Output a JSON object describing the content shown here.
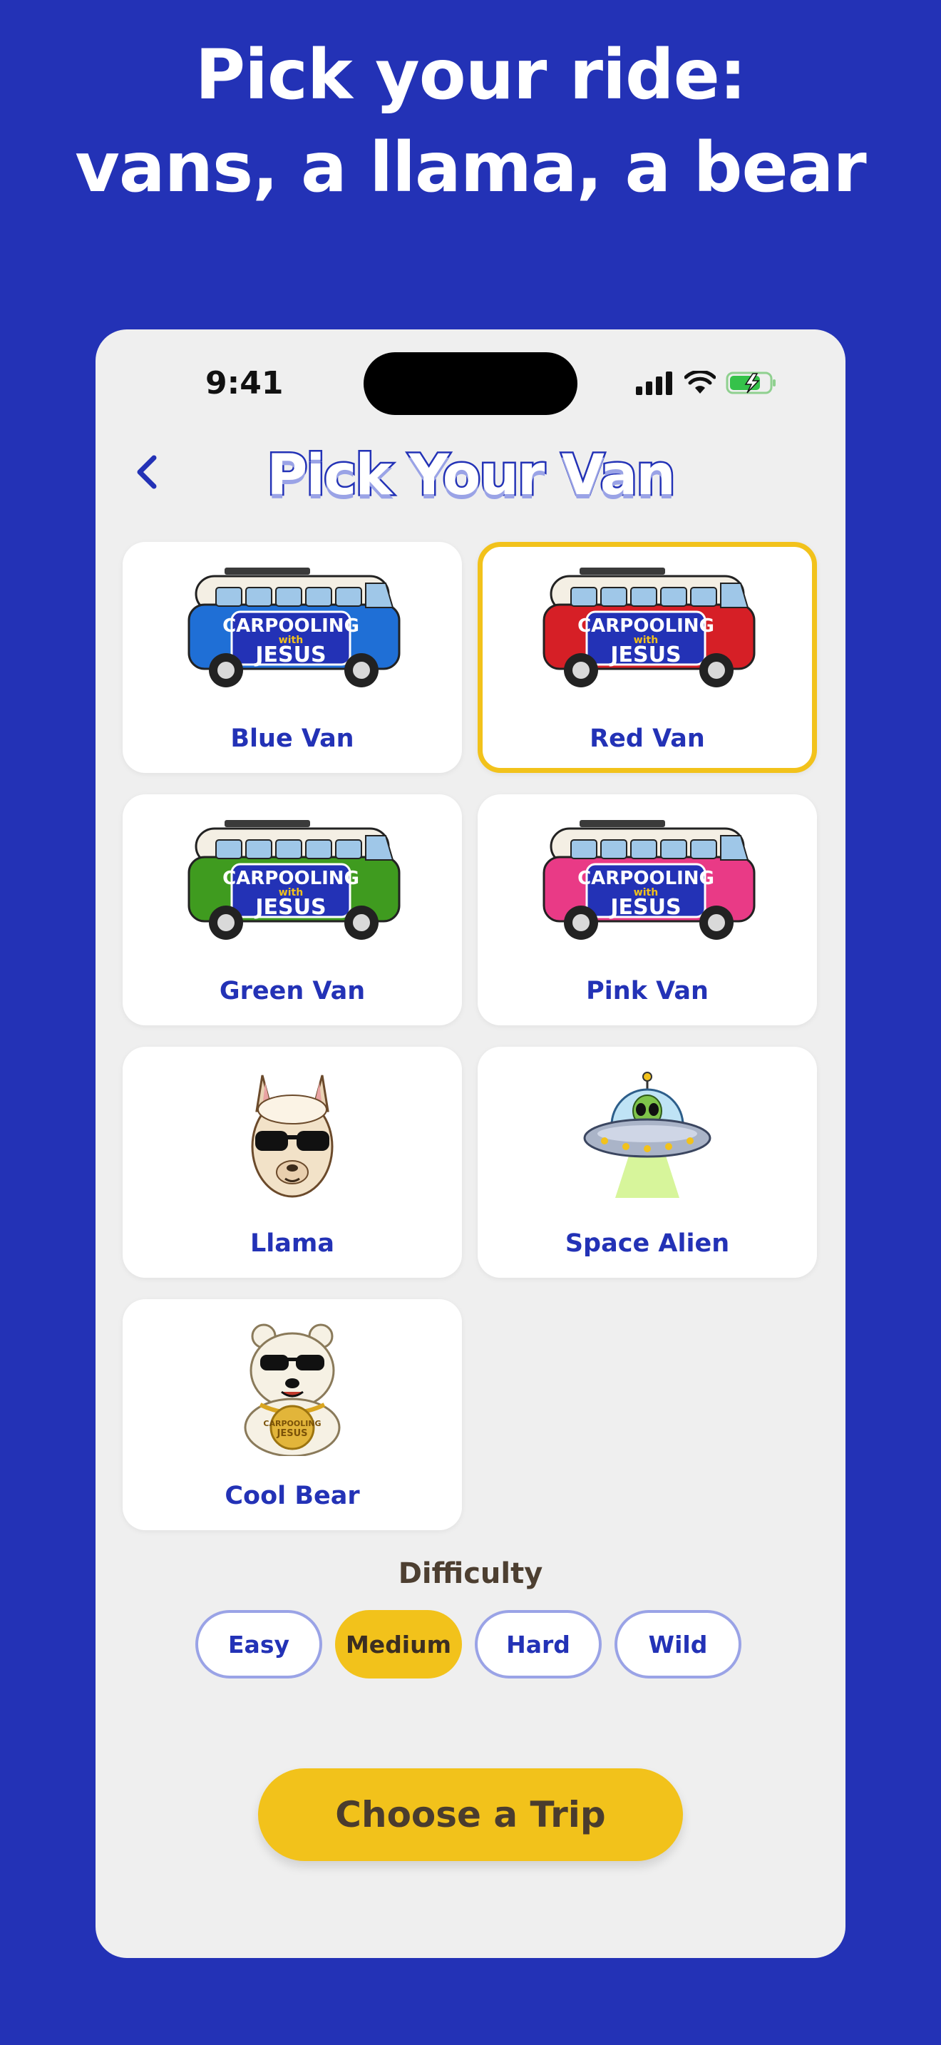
{
  "headline": {
    "line1": "Pick your ride:",
    "line2": "vans, a llama, a bear"
  },
  "status_bar": {
    "time": "9:41"
  },
  "screen": {
    "title": "Pick Your Van"
  },
  "vehicles": [
    {
      "label": "Blue Van",
      "icon": "blue-van-icon",
      "color": "#1f6fd6",
      "selected": false,
      "badge_line1": "CARPOOLING",
      "badge_line2": "with",
      "badge_line3": "JESUS"
    },
    {
      "label": "Red Van",
      "icon": "red-van-icon",
      "color": "#d61f26",
      "selected": true,
      "badge_line1": "CARPOOLING",
      "badge_line2": "with",
      "badge_line3": "JESUS"
    },
    {
      "label": "Green Van",
      "icon": "green-van-icon",
      "color": "#3f9b1f",
      "selected": false,
      "badge_line1": "CARPOOLING",
      "badge_line2": "with",
      "badge_line3": "JESUS"
    },
    {
      "label": "Pink Van",
      "icon": "pink-van-icon",
      "color": "#e93a86",
      "selected": false,
      "badge_line1": "CARPOOLING",
      "badge_line2": "with",
      "badge_line3": "JESUS"
    },
    {
      "label": "Llama",
      "icon": "llama-icon",
      "selected": false
    },
    {
      "label": "Space Alien",
      "icon": "alien-ufo-icon",
      "selected": false
    },
    {
      "label": "Cool Bear",
      "icon": "polar-bear-icon",
      "selected": false,
      "medallion_line1": "CARPOOLING",
      "medallion_line2": "JESUS"
    }
  ],
  "difficulty": {
    "title": "Difficulty",
    "options": [
      "Easy",
      "Medium",
      "Hard",
      "Wild"
    ],
    "selected": "Medium"
  },
  "cta": {
    "label": "Choose a Trip"
  },
  "colors": {
    "background": "#2332b6",
    "accent": "#f2c21b",
    "card": "#ffffff",
    "panel": "#efefef"
  }
}
